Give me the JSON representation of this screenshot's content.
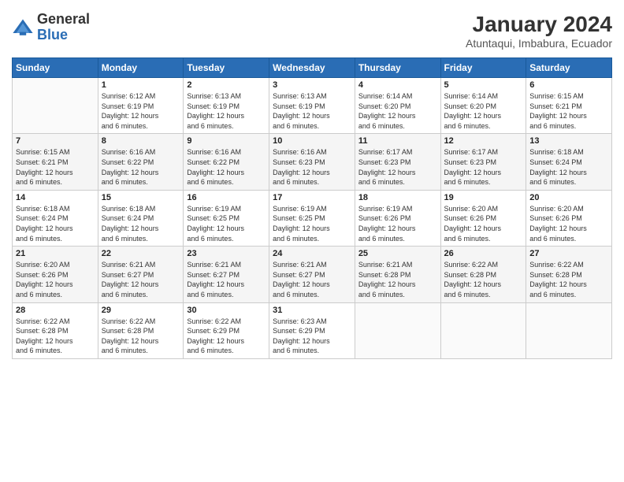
{
  "header": {
    "logo_general": "General",
    "logo_blue": "Blue",
    "title": "January 2024",
    "subtitle": "Atuntaqui, Imbabura, Ecuador"
  },
  "days_of_week": [
    "Sunday",
    "Monday",
    "Tuesday",
    "Wednesday",
    "Thursday",
    "Friday",
    "Saturday"
  ],
  "weeks": [
    [
      {
        "day": "",
        "info": ""
      },
      {
        "day": "1",
        "info": "Sunrise: 6:12 AM\nSunset: 6:19 PM\nDaylight: 12 hours\nand 6 minutes."
      },
      {
        "day": "2",
        "info": "Sunrise: 6:13 AM\nSunset: 6:19 PM\nDaylight: 12 hours\nand 6 minutes."
      },
      {
        "day": "3",
        "info": "Sunrise: 6:13 AM\nSunset: 6:19 PM\nDaylight: 12 hours\nand 6 minutes."
      },
      {
        "day": "4",
        "info": "Sunrise: 6:14 AM\nSunset: 6:20 PM\nDaylight: 12 hours\nand 6 minutes."
      },
      {
        "day": "5",
        "info": "Sunrise: 6:14 AM\nSunset: 6:20 PM\nDaylight: 12 hours\nand 6 minutes."
      },
      {
        "day": "6",
        "info": "Sunrise: 6:15 AM\nSunset: 6:21 PM\nDaylight: 12 hours\nand 6 minutes."
      }
    ],
    [
      {
        "day": "7",
        "info": "Sunrise: 6:15 AM\nSunset: 6:21 PM\nDaylight: 12 hours\nand 6 minutes."
      },
      {
        "day": "8",
        "info": "Sunrise: 6:16 AM\nSunset: 6:22 PM\nDaylight: 12 hours\nand 6 minutes."
      },
      {
        "day": "9",
        "info": "Sunrise: 6:16 AM\nSunset: 6:22 PM\nDaylight: 12 hours\nand 6 minutes."
      },
      {
        "day": "10",
        "info": "Sunrise: 6:16 AM\nSunset: 6:23 PM\nDaylight: 12 hours\nand 6 minutes."
      },
      {
        "day": "11",
        "info": "Sunrise: 6:17 AM\nSunset: 6:23 PM\nDaylight: 12 hours\nand 6 minutes."
      },
      {
        "day": "12",
        "info": "Sunrise: 6:17 AM\nSunset: 6:23 PM\nDaylight: 12 hours\nand 6 minutes."
      },
      {
        "day": "13",
        "info": "Sunrise: 6:18 AM\nSunset: 6:24 PM\nDaylight: 12 hours\nand 6 minutes."
      }
    ],
    [
      {
        "day": "14",
        "info": "Sunrise: 6:18 AM\nSunset: 6:24 PM\nDaylight: 12 hours\nand 6 minutes."
      },
      {
        "day": "15",
        "info": "Sunrise: 6:18 AM\nSunset: 6:24 PM\nDaylight: 12 hours\nand 6 minutes."
      },
      {
        "day": "16",
        "info": "Sunrise: 6:19 AM\nSunset: 6:25 PM\nDaylight: 12 hours\nand 6 minutes."
      },
      {
        "day": "17",
        "info": "Sunrise: 6:19 AM\nSunset: 6:25 PM\nDaylight: 12 hours\nand 6 minutes."
      },
      {
        "day": "18",
        "info": "Sunrise: 6:19 AM\nSunset: 6:26 PM\nDaylight: 12 hours\nand 6 minutes."
      },
      {
        "day": "19",
        "info": "Sunrise: 6:20 AM\nSunset: 6:26 PM\nDaylight: 12 hours\nand 6 minutes."
      },
      {
        "day": "20",
        "info": "Sunrise: 6:20 AM\nSunset: 6:26 PM\nDaylight: 12 hours\nand 6 minutes."
      }
    ],
    [
      {
        "day": "21",
        "info": "Sunrise: 6:20 AM\nSunset: 6:26 PM\nDaylight: 12 hours\nand 6 minutes."
      },
      {
        "day": "22",
        "info": "Sunrise: 6:21 AM\nSunset: 6:27 PM\nDaylight: 12 hours\nand 6 minutes."
      },
      {
        "day": "23",
        "info": "Sunrise: 6:21 AM\nSunset: 6:27 PM\nDaylight: 12 hours\nand 6 minutes."
      },
      {
        "day": "24",
        "info": "Sunrise: 6:21 AM\nSunset: 6:27 PM\nDaylight: 12 hours\nand 6 minutes."
      },
      {
        "day": "25",
        "info": "Sunrise: 6:21 AM\nSunset: 6:28 PM\nDaylight: 12 hours\nand 6 minutes."
      },
      {
        "day": "26",
        "info": "Sunrise: 6:22 AM\nSunset: 6:28 PM\nDaylight: 12 hours\nand 6 minutes."
      },
      {
        "day": "27",
        "info": "Sunrise: 6:22 AM\nSunset: 6:28 PM\nDaylight: 12 hours\nand 6 minutes."
      }
    ],
    [
      {
        "day": "28",
        "info": "Sunrise: 6:22 AM\nSunset: 6:28 PM\nDaylight: 12 hours\nand 6 minutes."
      },
      {
        "day": "29",
        "info": "Sunrise: 6:22 AM\nSunset: 6:28 PM\nDaylight: 12 hours\nand 6 minutes."
      },
      {
        "day": "30",
        "info": "Sunrise: 6:22 AM\nSunset: 6:29 PM\nDaylight: 12 hours\nand 6 minutes."
      },
      {
        "day": "31",
        "info": "Sunrise: 6:23 AM\nSunset: 6:29 PM\nDaylight: 12 hours\nand 6 minutes."
      },
      {
        "day": "",
        "info": ""
      },
      {
        "day": "",
        "info": ""
      },
      {
        "day": "",
        "info": ""
      }
    ]
  ]
}
